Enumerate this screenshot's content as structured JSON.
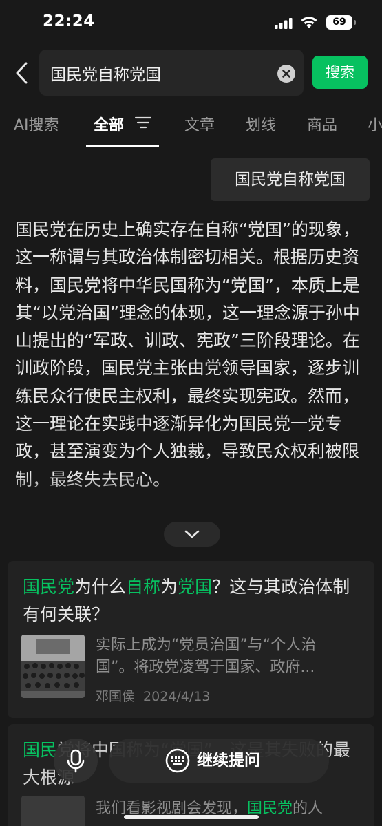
{
  "status": {
    "time": "22:24",
    "battery": "69"
  },
  "search": {
    "query": "国民党自称党国",
    "button": "搜索"
  },
  "tabs": [
    "AI搜索",
    "全部",
    "文章",
    "划线",
    "商品",
    "小"
  ],
  "active_tab": "全部",
  "query_bubble": "国民党自称党国",
  "answer": {
    "text": "国民党在历史上确实存在自称“党国”的现象，这一称谓与其政治体制密切相关。根据历史资料，国民党将中华民国称为“党国”，本质上是其“以党治国”理念的体现，这一理念源于孙中山提出的“军政、训政、宪政”三阶段理论。在训政阶段，国民党主张由党领导国家，逐步训练民众行使民主权利，最终实现宪政。然而，这一理论在实践中逐渐异化为国民党一党专政，甚至演变为个人独裁，导致民众权利被限制，最终失去民心。"
  },
  "cards": [
    {
      "title_parts": [
        {
          "text": "国民党",
          "hl": true
        },
        {
          "text": "为什么",
          "hl": false
        },
        {
          "text": "自称",
          "hl": true
        },
        {
          "text": "为",
          "hl": false
        },
        {
          "text": "党国",
          "hl": true
        },
        {
          "text": "？这与其政治体制有何关联？",
          "hl": false
        }
      ],
      "snippet_line1": "实际上成为“党员治国”与“个人治",
      "snippet_line2": "国”。将政党凌驾于国家、政府...",
      "author": "邓国侯",
      "date": "2024/4/13"
    },
    {
      "title_parts": [
        {
          "text": "国民",
          "hl": true
        },
        {
          "text": "党将中国称为“党国”，这是其失败的最大根源",
          "hl": false
        }
      ],
      "snippet_parts": [
        {
          "text": "我们看影视剧会发现，",
          "hl": false
        },
        {
          "text": "国民党",
          "hl": true
        },
        {
          "text": "的人",
          "hl": false
        }
      ]
    }
  ],
  "bottom_bar": {
    "continue_label": "继续提问"
  },
  "colors": {
    "accent": "#07c160",
    "background": "#191919"
  }
}
